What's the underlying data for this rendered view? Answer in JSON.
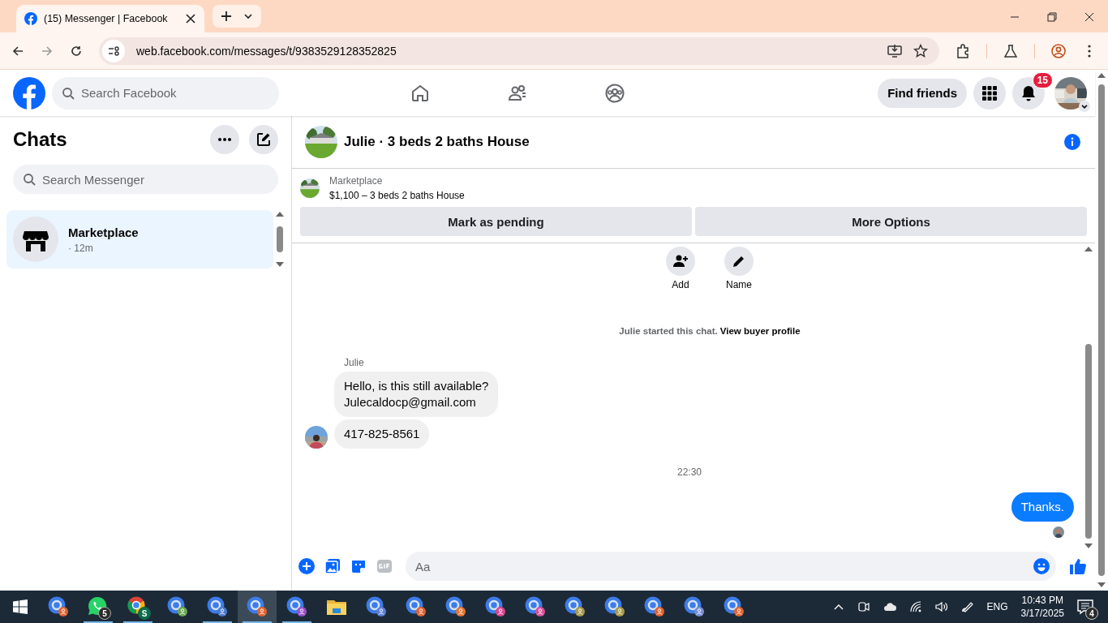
{
  "browser": {
    "tab_title": "(15) Messenger | Facebook",
    "url": "web.facebook.com/messages/t/9383529128352825"
  },
  "header": {
    "search_placeholder": "Search Facebook",
    "find_friends": "Find friends",
    "notifications": "15"
  },
  "sidebar": {
    "title": "Chats",
    "search_placeholder": "Search Messenger",
    "chats": [
      {
        "name": "Marketplace",
        "time": "· 12m",
        "selected": true
      }
    ]
  },
  "conversation": {
    "title": "Julie · 3 beds 2 baths House",
    "listing": {
      "source": "Marketplace",
      "title": "$1,100 – 3 beds 2 baths House"
    },
    "buttons": [
      "Mark as pending",
      "More Options"
    ],
    "actions": [
      {
        "kind": "add",
        "label": "Add"
      },
      {
        "kind": "name",
        "label": "Name"
      }
    ],
    "notice": {
      "text": "Julie started this chat.",
      "link": "View buyer profile"
    },
    "messages": [
      {
        "kind": "incoming",
        "sender": "Julie",
        "text": "Hello, is this still available?\nJulecaldocp@gmail.com",
        "avatar": false
      },
      {
        "kind": "incoming",
        "text": "417-825-8561",
        "avatar": true
      },
      {
        "kind": "time",
        "text": "22:30"
      },
      {
        "kind": "outgoing",
        "text": "Thanks.",
        "seen": true
      }
    ],
    "composer": {
      "placeholder": "Aa"
    }
  },
  "taskbar": {
    "apps": [
      {
        "kind": "profile",
        "color": "#e2622f",
        "running": false,
        "selected": false
      },
      {
        "kind": "whatsapp",
        "badge": "5",
        "running": true,
        "selected": false
      },
      {
        "kind": "chrome",
        "badge": "S",
        "running": true,
        "selected": false
      },
      {
        "kind": "profile",
        "color": "#6aa84f",
        "running": false,
        "selected": false
      },
      {
        "kind": "profile",
        "color": "#4a7bd0",
        "running": true,
        "selected": false
      },
      {
        "kind": "profile",
        "color": "#e2622f",
        "running": true,
        "selected": true
      },
      {
        "kind": "profile",
        "color": "#9b4fc9",
        "running": true,
        "selected": false
      },
      {
        "kind": "files",
        "running": false,
        "selected": false
      },
      {
        "kind": "profile",
        "color": "#5b7fd6",
        "running": false,
        "selected": false
      },
      {
        "kind": "profile",
        "color": "#e2622f",
        "running": false,
        "selected": false
      },
      {
        "kind": "profile",
        "color": "#e8742f",
        "running": false,
        "selected": false
      },
      {
        "kind": "profile",
        "color": "#d9468f",
        "running": false,
        "selected": false
      },
      {
        "kind": "profile",
        "color": "#d94f9a",
        "running": false,
        "selected": false
      },
      {
        "kind": "profile",
        "color": "#a79a4a",
        "running": false,
        "selected": false
      },
      {
        "kind": "profile",
        "color": "#a89a4a",
        "running": false,
        "selected": false
      },
      {
        "kind": "profile",
        "color": "#e2622f",
        "running": false,
        "selected": false
      },
      {
        "kind": "profile",
        "color": "#7a8fd6",
        "running": false,
        "selected": false
      },
      {
        "kind": "profile",
        "color": "#e8642f",
        "running": false,
        "selected": false
      }
    ],
    "language": "ENG",
    "time": "10:43 PM",
    "date": "3/17/2025",
    "notifications": "4"
  }
}
